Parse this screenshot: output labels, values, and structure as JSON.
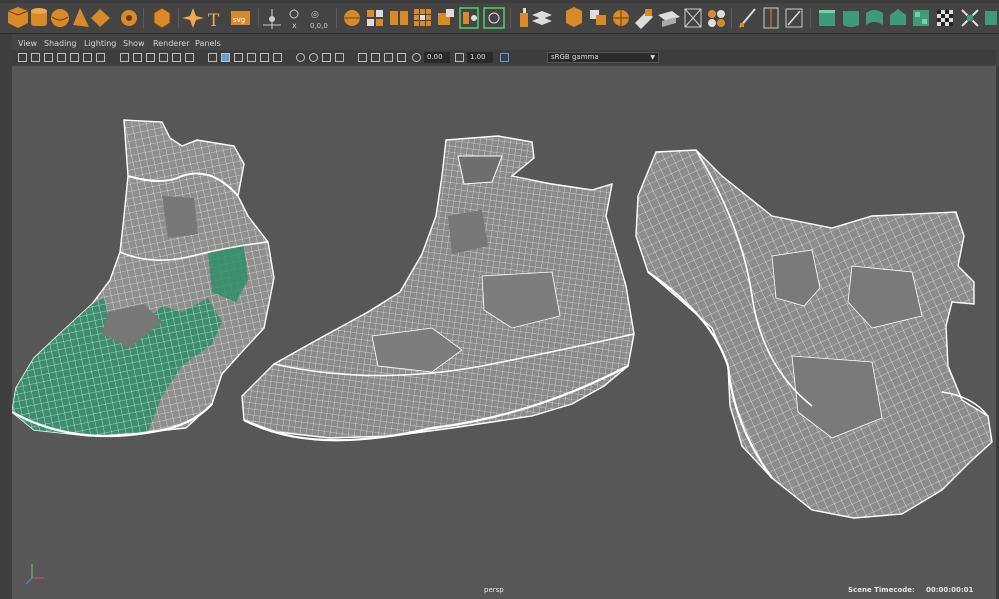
{
  "panel_menu": [
    "View",
    "Shading",
    "Lighting",
    "Show",
    "Renderer",
    "Panels"
  ],
  "panel_toolbar": {
    "exposure_value": "0.00",
    "gamma_value": "1.00",
    "color_space": "sRGB gamma"
  },
  "shelf_icons": [
    "polygon-cube-icon",
    "polygon-cylinder-icon",
    "polygon-sphere-icon",
    "polygon-cone-icon",
    "polygon-torus-icon",
    "soccer-ball-icon",
    "super-shape-icon",
    "type-text-icon",
    "svg-icon",
    "center-pivot-icon",
    "freeze-transform-icon",
    "freeze-transform-xyz-icon",
    "combine-icon",
    "extract-icon",
    "separate-icon",
    "smooth-icon",
    "boolean-icon",
    "mirror-icon",
    "mirror-symmetric-icon",
    "extrude-icon",
    "bridge-icon",
    "bevel-icon",
    "poke-icon",
    "wedge-icon",
    "bevel-edge-icon",
    "fill-hole-icon",
    "merge-icon",
    "target-weld-icon",
    "multi-cut-icon",
    "insert-edgeloop-icon",
    "offset-edgeloop-icon",
    "uv-planar-icon",
    "uv-cylindrical-icon",
    "uv-spherical-icon",
    "uv-automatic-icon",
    "uv-checker-icon",
    "uv-layout-icon"
  ],
  "viewport": {
    "camera": "persp",
    "timecode_label": "Scene Timecode:",
    "timecode_value": "00:00:00:01"
  },
  "colors": {
    "shelf_orange": "#d98a28",
    "shelf_green": "#3f9a7a",
    "viewport_bg": "#575757",
    "wireframe": "#ffffff",
    "selected_faces": "#2f8e6a"
  }
}
